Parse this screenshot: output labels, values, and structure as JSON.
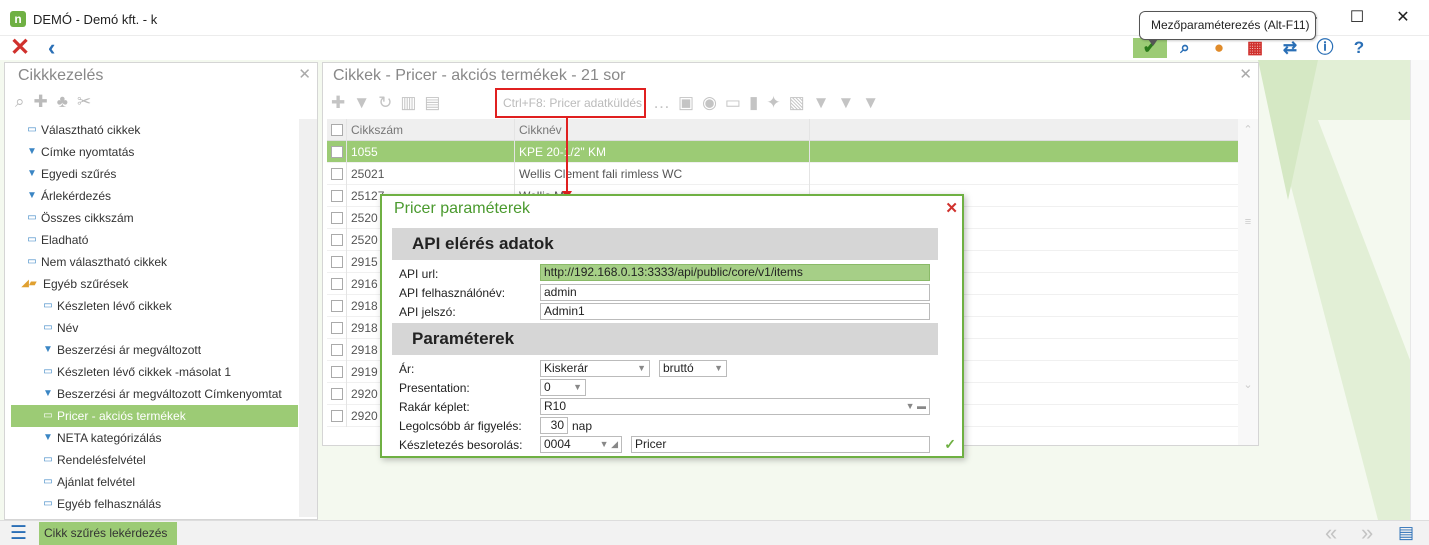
{
  "window": {
    "logo": "n",
    "title": "DEMÓ - Demó kft. - k",
    "minimize": "—",
    "maximize": "☐",
    "close": "✕"
  },
  "tooltip": "Mezőparaméterezés (Alt-F11)",
  "left_panel": {
    "title": "Cikkkezelés",
    "items": [
      {
        "label": "Választható cikkek",
        "icon": "monitor",
        "indent": 0
      },
      {
        "label": "Címke nyomtatás",
        "icon": "filter",
        "indent": 0
      },
      {
        "label": "Egyedi szűrés",
        "icon": "filter",
        "indent": 0
      },
      {
        "label": "Árlekérdezés",
        "icon": "filter",
        "indent": 0
      },
      {
        "label": "Összes cikkszám",
        "icon": "monitor",
        "indent": 0
      },
      {
        "label": "Eladható",
        "icon": "monitor",
        "indent": 0
      },
      {
        "label": "Nem választható cikkek",
        "icon": "monitor",
        "indent": 0
      },
      {
        "label": "Egyéb szűrések",
        "icon": "folder",
        "indent": 0
      },
      {
        "label": "Készleten lévő cikkek",
        "icon": "monitor",
        "indent": 1
      },
      {
        "label": "Név",
        "icon": "monitor",
        "indent": 1
      },
      {
        "label": "Beszerzési ár megváltozott",
        "icon": "filter",
        "indent": 1
      },
      {
        "label": "Készleten lévő cikkek -másolat 1",
        "icon": "monitor",
        "indent": 1
      },
      {
        "label": "Beszerzési ár megváltozott  Címkenyomtat",
        "icon": "filter",
        "indent": 1
      },
      {
        "label": "Pricer - akciós termékek",
        "icon": "monitor",
        "indent": 1,
        "selected": true
      },
      {
        "label": "NETA kategórizálás",
        "icon": "filter",
        "indent": 1
      },
      {
        "label": "Rendelésfelvétel",
        "icon": "monitor",
        "indent": 1
      },
      {
        "label": "Ajánlat felvétel",
        "icon": "monitor",
        "indent": 1
      },
      {
        "label": "Egyéb felhasználás",
        "icon": "monitor",
        "indent": 1
      }
    ]
  },
  "main_panel": {
    "title": "Cikkek - Pricer - akciós termékek - 21 sor",
    "highlight_button": "Ctrl+F8: Pricer adatküldés",
    "columns": [
      "Cikkszám",
      "Cikknév"
    ],
    "rows": [
      {
        "code": "1055",
        "name": "KPE 20-1/2\" KM",
        "selected": true
      },
      {
        "code": "25021",
        "name": "Wellis Clement fali rimless WC"
      },
      {
        "code": "25127",
        "name": "Wellis M..."
      },
      {
        "code": "2520",
        "name": ""
      },
      {
        "code": "2520",
        "name": ""
      },
      {
        "code": "2915",
        "name": ""
      },
      {
        "code": "2916",
        "name": ""
      },
      {
        "code": "2918",
        "name": ""
      },
      {
        "code": "2918",
        "name": ""
      },
      {
        "code": "2918",
        "name": ""
      },
      {
        "code": "2919",
        "name": ""
      },
      {
        "code": "2920",
        "name": ""
      },
      {
        "code": "2920",
        "name": ""
      }
    ]
  },
  "dialog": {
    "title": "Pricer paraméterek",
    "section_api": "API elérés adatok",
    "api_url_label": "API url:",
    "api_url": "http://192.168.0.13:3333/api/public/core/v1/items",
    "api_user_label": "API felhasználónév:",
    "api_user": "admin",
    "api_pass_label": "API jelszó:",
    "api_pass": "Admin1",
    "section_params": "Paraméterek",
    "price_label": "Ár:",
    "price_value": "Kiskerár",
    "gross_value": "bruttó",
    "presentation_label": "Presentation:",
    "presentation_value": "0",
    "rakar_label": "Rakár képlet:",
    "rakar_value": "R10",
    "cheapest_label": "Legolcsóbb ár figyelés:",
    "cheapest_value": "30",
    "cheapest_unit": "nap",
    "stock_label": "Készletezés besorolás:",
    "stock_code": "0004",
    "stock_name": "Pricer"
  },
  "status_bar": {
    "tab": "Cikk szűrés lekérdezés"
  },
  "colors": {
    "accent_green": "#9ccb75",
    "dialog_border": "#6fb043",
    "highlight_red": "#e02020",
    "link_blue": "#2a6fb6"
  }
}
